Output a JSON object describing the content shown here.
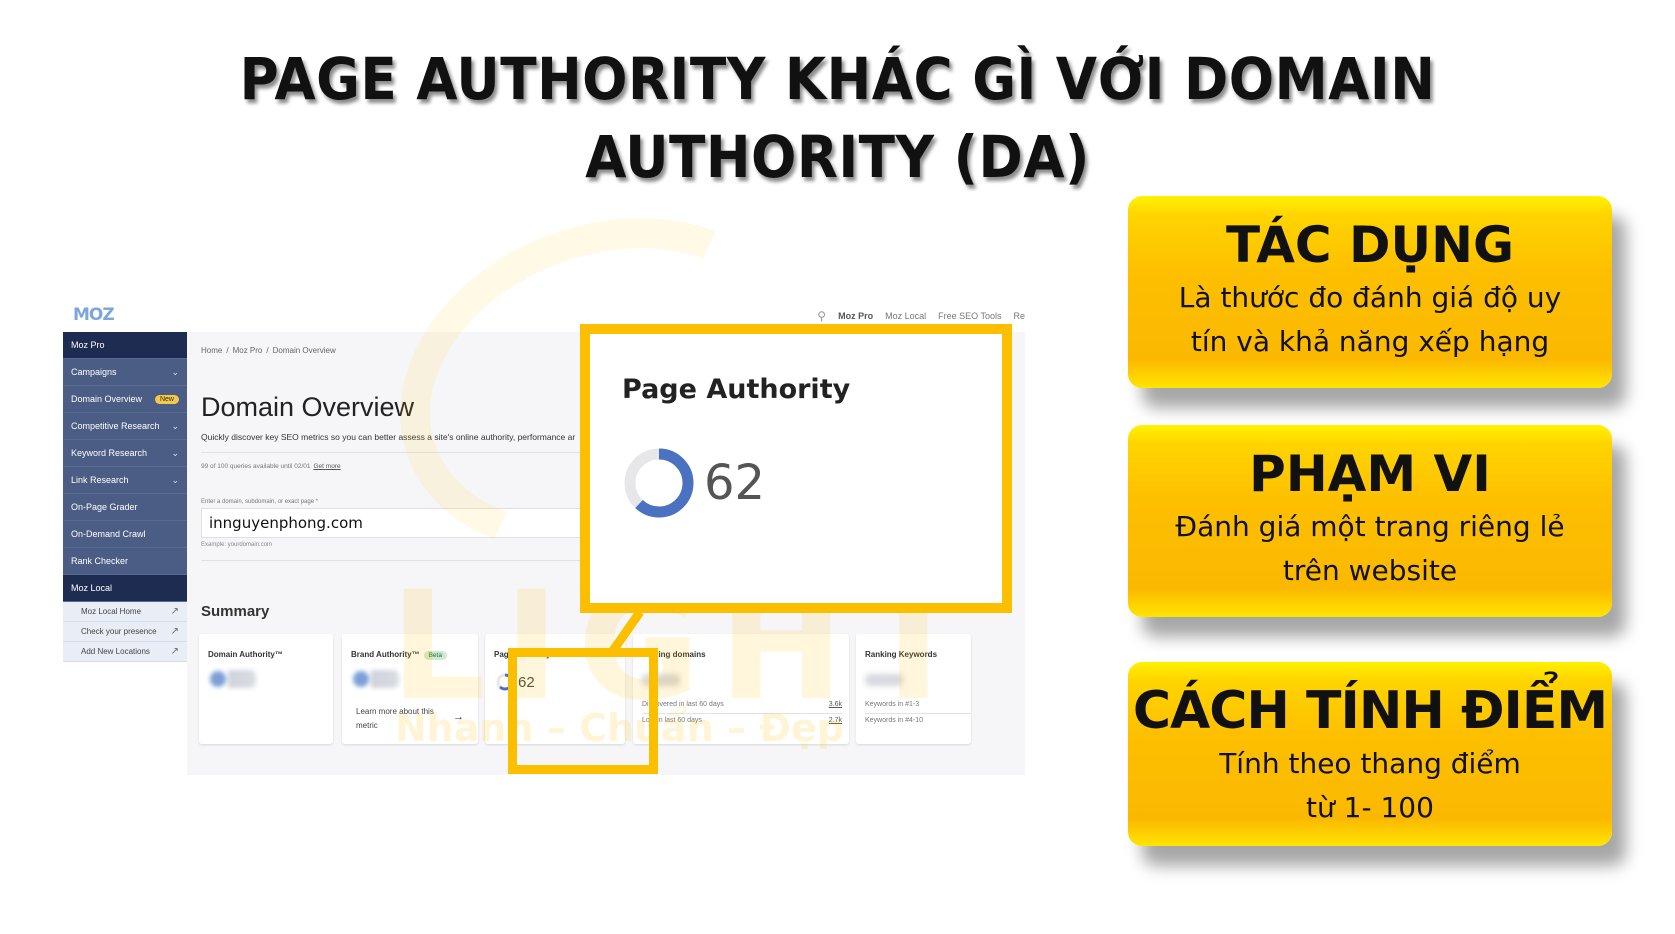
{
  "slide": {
    "title_line1": "PAGE AUTHORITY KHÁC GÌ VỚI DOMAIN",
    "title_line2": "AUTHORITY (DA)",
    "accent_color": "#fcbf00"
  },
  "watermark": {
    "brand": "LIGHT",
    "slogan": "Nhanh – Chuẩn – Đẹp"
  },
  "moz": {
    "logo": "MOZ",
    "top_nav": {
      "search_icon": "search-icon",
      "items": [
        "Moz Pro",
        "Moz Local",
        "Free SEO Tools",
        "Re"
      ]
    },
    "sidebar": {
      "items": [
        {
          "label": "Moz Pro",
          "type": "header"
        },
        {
          "label": "Campaigns",
          "chevron": true
        },
        {
          "label": "Domain Overview",
          "badge": "New"
        },
        {
          "label": "Competitive Research",
          "chevron": true
        },
        {
          "label": "Keyword Research",
          "chevron": true
        },
        {
          "label": "Link Research",
          "chevron": true
        },
        {
          "label": "On-Page Grader"
        },
        {
          "label": "On-Demand Crawl"
        },
        {
          "label": "Rank Checker"
        },
        {
          "label": "Moz Local",
          "type": "header"
        }
      ],
      "sub_items": [
        {
          "label": "Moz Local Home",
          "icon": "external-link-icon"
        },
        {
          "label": "Check your presence",
          "icon": "external-link-icon"
        },
        {
          "label": "Add New Locations",
          "icon": "external-link-icon"
        }
      ]
    },
    "breadcrumb": [
      "Home",
      "Moz Pro",
      "Domain Overview"
    ],
    "page_title": "Domain Overview",
    "page_description": "Quickly discover key SEO metrics so you can better assess a site's online authority, performance ar",
    "quota_text": "99 of 100 queries available until 02/01",
    "quota_link": "Get more",
    "input_label": "Enter a domain, subdomain, or exact page *",
    "input_value": "innguyenphong.com",
    "input_hint": "Example: yourdomain.com",
    "summary_title": "Summary",
    "cards": {
      "domain_authority": {
        "title": "Domain Authority™"
      },
      "brand_authority": {
        "title": "Brand Authority™",
        "badge": "Beta",
        "link": "Learn more about this metric",
        "arrow": "→"
      },
      "page_authority": {
        "title": "Page Authority",
        "value": "62",
        "percent": 62
      },
      "linking_domains": {
        "title": "Linking domains",
        "rows": [
          {
            "label": "Discovered in last 60 days",
            "value": "3.6k"
          },
          {
            "label": "Lost in last 60 days",
            "value": "2.7k"
          }
        ]
      },
      "ranking_keywords": {
        "title": "Ranking Keywords",
        "rows": [
          {
            "label": "Keywords in #1-3"
          },
          {
            "label": "Keywords in #4-10"
          }
        ]
      }
    },
    "callout": {
      "title": "Page Authority",
      "value": "62",
      "percent": 62
    }
  },
  "info_cards": [
    {
      "title": "TÁC DỤNG",
      "body_line1": "Là thước đo đánh giá độ uy",
      "body_line2": "tín và khả năng xếp hạng"
    },
    {
      "title": "PHẠM VI",
      "body_line1": "Đánh giá một trang riêng lẻ",
      "body_line2": "trên website"
    },
    {
      "title": "CÁCH TÍNH ĐIỂM",
      "body_line1": "Tính theo thang điểm",
      "body_line2": "từ 1- 100"
    }
  ]
}
